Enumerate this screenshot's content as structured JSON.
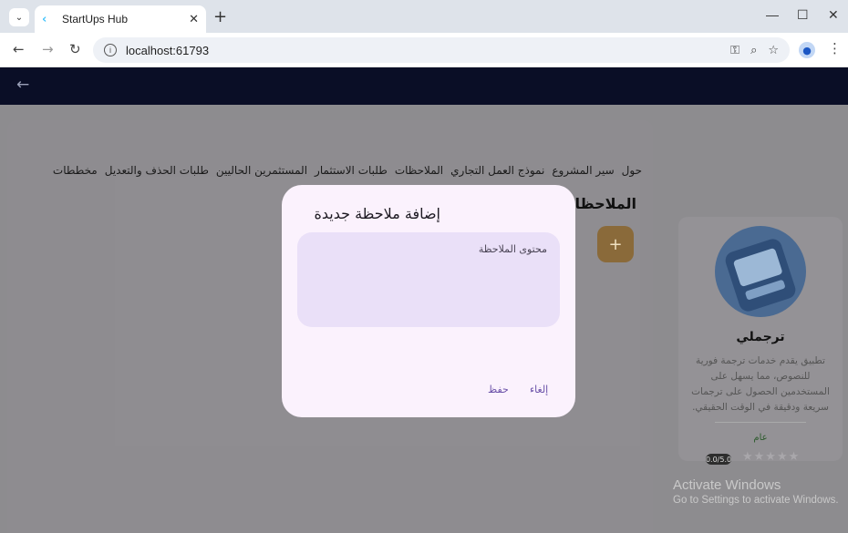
{
  "browser": {
    "tab_title": "StartUps Hub",
    "url": "localhost:61793"
  },
  "app": {
    "tabs": [
      "حول",
      "سير المشروع",
      "نموذج العمل التجاري",
      "الملاحظات",
      "طلبات الاستثمار",
      "المستثمرين الحاليين",
      "طلبات الحذف والتعديل",
      "مخططات"
    ],
    "section_title": "الملاحظات",
    "fab_label": "+"
  },
  "side_card": {
    "title": "ترجملي",
    "description": "تطبيق يقدم خدمات ترجمة فورية للنصوص، مما يسهل على المستخدمين الحصول على ترجمات سريعة ودقيقة في الوقت الحقيقي.",
    "category": "عام",
    "rating": "0.0/5.0",
    "stars": "★★★★★"
  },
  "dialog": {
    "title": "إضافة ملاحظة جديدة",
    "placeholder": "محتوى الملاحظة",
    "cancel_label": "إلغاء",
    "save_label": "حفظ"
  },
  "watermark": {
    "title": "Activate Windows",
    "subtitle": "Go to Settings to activate Windows."
  }
}
